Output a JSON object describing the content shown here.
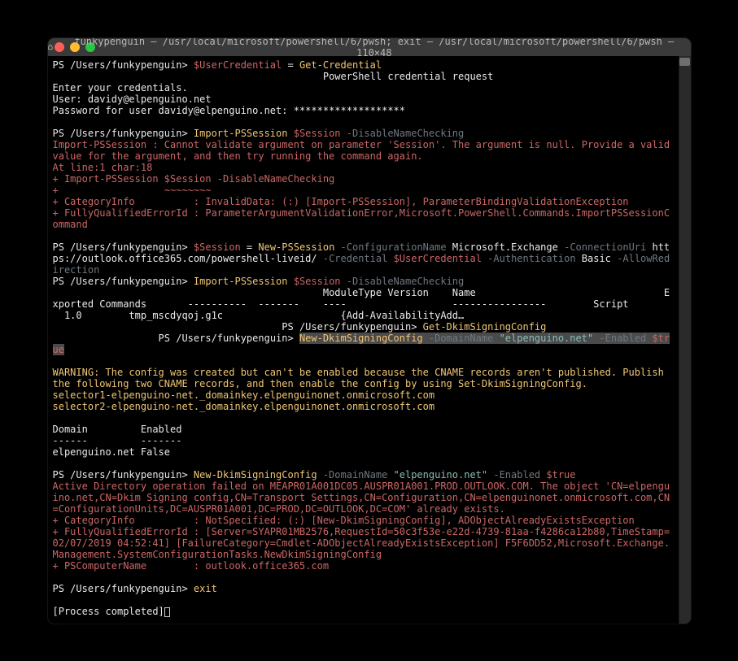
{
  "window": {
    "title_prefix": "funkypenguin — /usr/local/microsoft/powershell/6/pwsh; exit — /usr/local/microsoft/powershell/6/pwsh — 110×48"
  },
  "prompt": {
    "ps": "PS /Users/funkypenguin> ",
    "ps_alt": "PS /Users/funkypenguin> "
  },
  "cmd1": {
    "var": "$UserCredential",
    "eq": " = ",
    "call": "Get-Credential"
  },
  "cred": {
    "header_spaces": "                                              ",
    "header": "PowerShell credential request",
    "line1": "Enter your credentials.",
    "line2_label": "User: ",
    "line2_val": "davidy@elpenguino.net",
    "line3_label": "Password for user davidy@elpenguino.net: ",
    "line3_val": "*******************"
  },
  "cmd2": {
    "call": "Import-PSSession",
    "space": " ",
    "var": "$Session",
    "flag": "-DisableNameChecking"
  },
  "err1": {
    "l1": "Import-PSSession : Cannot validate argument on parameter 'Session'. The argument is null. Provide a valid value for the argument, and then try running the command again.",
    "l2": "At line:1 char:18",
    "l3": "+ Import-PSSession $Session -DisableNameChecking",
    "l4": "+                  ~~~~~~~~",
    "l5": "+ CategoryInfo          : InvalidData: (:) [Import-PSSession], ParameterBindingValidationException",
    "l6": "+ FullyQualifiedErrorId : ParameterArgumentValidationError,Microsoft.PowerShell.Commands.ImportPSSessionCommand"
  },
  "cmd3": {
    "var": "$Session",
    "eq": " = ",
    "call": "New-PSSession",
    "flag1": "-ConfigurationName",
    "arg1": "Microsoft.Exchange",
    "flag2": "-ConnectionUri",
    "arg2": "https://outlook.office365.com/powershell-liveid/",
    "flag3": "-Credential",
    "arg3": "$UserCredential",
    "flag4": "-Authentication",
    "arg4": "Basic",
    "flag5": "-AllowRedirection"
  },
  "table": {
    "header": "                                              ModuleType Version    Name                                Exported Commands       ----------  -------    ----                  ----------------        Script",
    "row": "  1.0        tmp_mscdyqoj.g1c                    {Add-AvailabilityAdd…"
  },
  "cmd4prompt": "                                       PS /Users/funkypenguin> ",
  "cmd4": {
    "call": "Get-DkimSigningConfig"
  },
  "cmd5prompt": "                  PS /Users/funkypenguin> ",
  "cmd5": {
    "call": "New-DkimSigningConfig",
    "flag1": " -DomainName ",
    "arg1": "\"elpenguino.net\"",
    "flag2": " -Enabled ",
    "arg2": "$true"
  },
  "warn": {
    "l1": "WARNING: The config was created but can't be enabled because the CNAME records aren't published. Publish the following two CNAME records, and then enable the config by using Set-DkimSigningConfig.",
    "l2": "selector1-elpenguino-net._domainkey.elpenguinonet.onmicrosoft.com",
    "l3": "selector2-elpenguino-net._domainkey.elpenguinonet.onmicrosoft.com"
  },
  "result": {
    "h1": "Domain         Enabled",
    "h2": "------         -------",
    "r1": "elpenguino.net False"
  },
  "cmd6": {
    "call": "New-DkimSigningConfig",
    "flag1": " -DomainName ",
    "arg1": "\"elpenguino.net\"",
    "flag2": " -Enabled ",
    "arg2": "$true"
  },
  "err2": {
    "l1": "Active Directory operation failed on MEAPR01A001DC05.AUSPR01A001.PROD.OUTLOOK.COM. The object 'CN=elpenguino.net,CN=Dkim Signing config,CN=Transport Settings,CN=Configuration,CN=elpenguinonet.onmicrosoft.com,CN=ConfigurationUnits,DC=AUSPR01A001,DC=PROD,DC=OUTLOOK,DC=COM' already exists.",
    "l2": "+ CategoryInfo          : NotSpecified: (:) [New-DkimSigningConfig], ADObjectAlreadyExistsException",
    "l3": "+ FullyQualifiedErrorId : [Server=SYAPR01MB2576,RequestId=50c3f53e-e22d-4739-81aa-f4286ca12b80,TimeStamp=02/07/2019 04:52:41] [FailureCategory=Cmdlet-ADObjectAlreadyExistsException] F5F6DD52,Microsoft.Exchange.Management.SystemConfigurationTasks.NewDkimSigningConfig",
    "l4": "+ PSComputerName        : outlook.office365.com"
  },
  "cmd7": {
    "call": "exit"
  },
  "proc": {
    "msg": "[Process completed]"
  }
}
